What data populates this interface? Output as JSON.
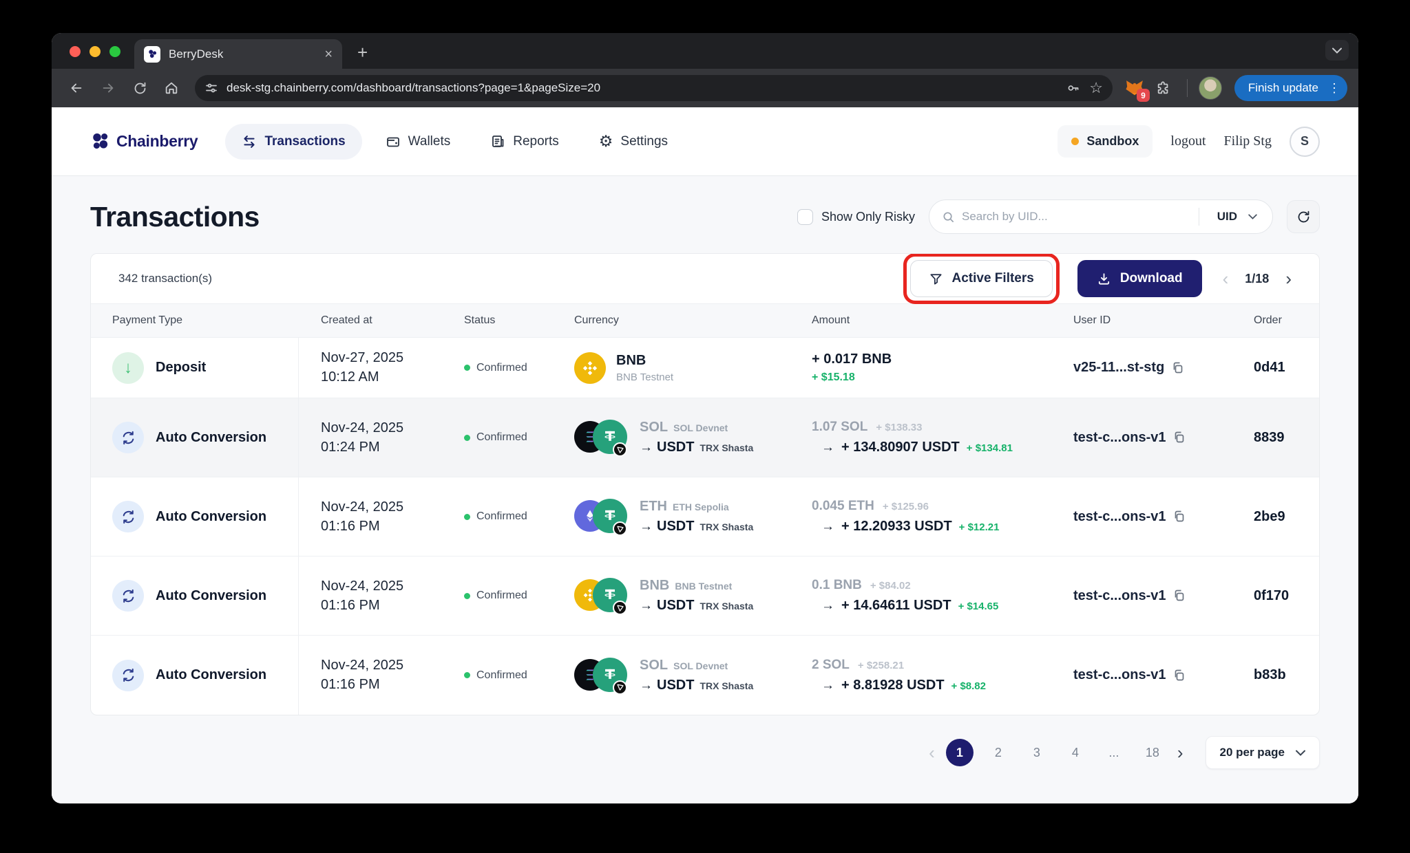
{
  "ui": {
    "arrow": "→",
    "close": "×",
    "plus": "+",
    "chev_left": "‹",
    "chev_right": "›",
    "kebab": "⋮",
    "star": "☆",
    "gear": "⚙",
    "down_arrow": "↓",
    "ellipsis_tab": ""
  },
  "browser": {
    "tab_title": "BerryDesk",
    "url": "desk-stg.chainberry.com/dashboard/transactions?page=1&pageSize=20",
    "update_button": "Finish update",
    "extension_badge": "9"
  },
  "nav": {
    "brand": "Chainberry",
    "items": [
      {
        "label": "Transactions"
      },
      {
        "label": "Wallets"
      },
      {
        "label": "Reports"
      },
      {
        "label": "Settings"
      }
    ],
    "environment": "Sandbox",
    "logout_label": "logout",
    "user_name": "Filip Stg",
    "user_initial": "S"
  },
  "page": {
    "title": "Transactions",
    "risky_label": "Show Only Risky",
    "search_placeholder": "Search by UID...",
    "search_filter": "UID"
  },
  "toolbar": {
    "count": "342 transaction(s)",
    "filters_label": "Active Filters",
    "download_label": "Download",
    "page_indicator": "1/18"
  },
  "table": {
    "headers": [
      "Payment Type",
      "Created at",
      "Status",
      "Currency",
      "Amount",
      "User ID",
      "Order"
    ],
    "rows": [
      {
        "kind": "deposit",
        "type": "Deposit",
        "date": "Nov-27, 2025",
        "time": "10:12 AM",
        "status": "Confirmed",
        "coin": "BNB",
        "network": "BNB Testnet",
        "coin_icon": "bnb-coin-icon",
        "amount": "+ 0.017 BNB",
        "fiat": "+ $15.18",
        "user_id": "v25-11...st-stg",
        "order": "0d41"
      },
      {
        "kind": "conversion",
        "type": "Auto Conversion",
        "date": "Nov-24, 2025",
        "time": "01:24 PM",
        "status": "Confirmed",
        "from_coin": "SOL",
        "from_network": "SOL Devnet",
        "from_icon": "sol-coin-icon",
        "to_coin": "USDT",
        "to_network": "TRX Shasta",
        "to_icon": "usdt-coin-icon",
        "badge_icon": "trx-badge-icon",
        "from_amount": "1.07 SOL",
        "from_fiat": "+ $138.33",
        "to_amount": "+ 134.80907 USDT",
        "to_fiat": "+ $134.81",
        "user_id": "test-c...ons-v1",
        "order": "8839"
      },
      {
        "kind": "conversion",
        "type": "Auto Conversion",
        "date": "Nov-24, 2025",
        "time": "01:16 PM",
        "status": "Confirmed",
        "from_coin": "ETH",
        "from_network": "ETH Sepolia",
        "from_icon": "eth-coin-icon",
        "to_coin": "USDT",
        "to_network": "TRX Shasta",
        "to_icon": "usdt-coin-icon",
        "badge_icon": "trx-badge-icon",
        "from_amount": "0.045 ETH",
        "from_fiat": "+ $125.96",
        "to_amount": "+ 12.20933 USDT",
        "to_fiat": "+ $12.21",
        "user_id": "test-c...ons-v1",
        "order": "2be9"
      },
      {
        "kind": "conversion",
        "type": "Auto Conversion",
        "date": "Nov-24, 2025",
        "time": "01:16 PM",
        "status": "Confirmed",
        "from_coin": "BNB",
        "from_network": "BNB Testnet",
        "from_icon": "bnb-coin-icon",
        "to_coin": "USDT",
        "to_network": "TRX Shasta",
        "to_icon": "usdt-coin-icon",
        "badge_icon": "trx-badge-icon",
        "from_amount": "0.1 BNB",
        "from_fiat": "+ $84.02",
        "to_amount": "+ 14.64611 USDT",
        "to_fiat": "+ $14.65",
        "user_id": "test-c...ons-v1",
        "order": "0f170"
      },
      {
        "kind": "conversion",
        "type": "Auto Conversion",
        "date": "Nov-24, 2025",
        "time": "01:16 PM",
        "status": "Confirmed",
        "from_coin": "SOL",
        "from_network": "SOL Devnet",
        "from_icon": "sol-coin-icon",
        "to_coin": "USDT",
        "to_network": "TRX Shasta",
        "to_icon": "usdt-coin-icon",
        "badge_icon": "trx-badge-icon",
        "from_amount": "2 SOL",
        "from_fiat": "+ $258.21",
        "to_amount": "+ 8.81928 USDT",
        "to_fiat": "+ $8.82",
        "user_id": "test-c...ons-v1",
        "order": "b83b"
      }
    ]
  },
  "pagination": {
    "pages": [
      "1",
      "2",
      "3",
      "4",
      "...",
      "18"
    ],
    "active_page": "1",
    "per_page": "20 per page"
  },
  "colors": {
    "brand_navy": "#201f70",
    "green": "#17b26a",
    "highlight_red": "#e8251f",
    "sandbox_orange": "#f5a623",
    "bnb_yellow": "#f0b90b",
    "usdt_teal": "#26a17b",
    "eth_indigo": "#6168dd"
  }
}
